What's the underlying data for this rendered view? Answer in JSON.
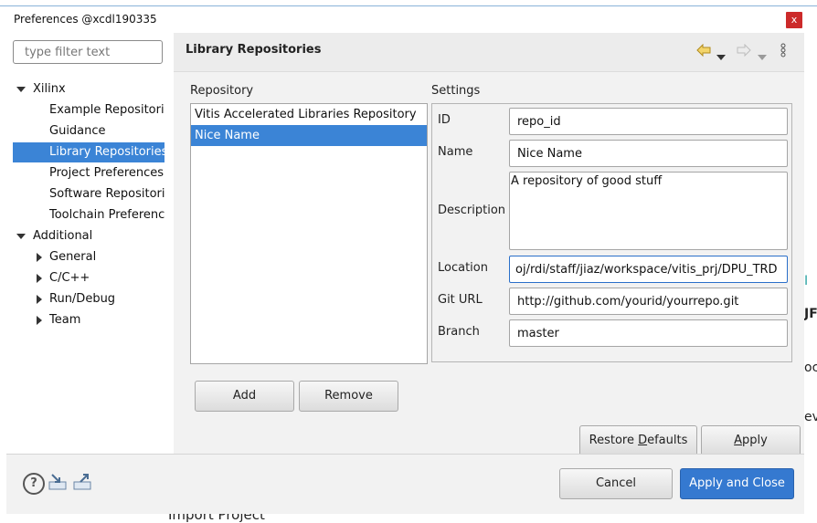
{
  "window": {
    "title": "Preferences @xcdl190335",
    "close_glyph": "x"
  },
  "filter": {
    "placeholder": "type filter text"
  },
  "tree": [
    {
      "label": "Xilinx",
      "expanded": true,
      "level": 0
    },
    {
      "label": "Example Repositori",
      "level": 1
    },
    {
      "label": "Guidance",
      "level": 1
    },
    {
      "label": "Library Repositories",
      "level": 1,
      "selected": true
    },
    {
      "label": "Project Preferences",
      "level": 1
    },
    {
      "label": "Software Repositori",
      "level": 1
    },
    {
      "label": "Toolchain Preferenc",
      "level": 1
    },
    {
      "label": "Additional",
      "expanded": true,
      "level": 0
    },
    {
      "label": "General",
      "expanded": false,
      "level": 1
    },
    {
      "label": "C/C++",
      "expanded": false,
      "level": 1
    },
    {
      "label": "Run/Debug",
      "expanded": false,
      "level": 1
    },
    {
      "label": "Team",
      "expanded": false,
      "level": 1
    }
  ],
  "page": {
    "title": "Library Repositories"
  },
  "repository": {
    "label": "Repository",
    "items": [
      "Vitis Accelerated Libraries Repository",
      "Nice Name"
    ],
    "selected": "Nice Name"
  },
  "settings": {
    "label": "Settings",
    "id_label": "ID",
    "id_value": "repo_id",
    "name_label": "Name",
    "name_value": "Nice Name",
    "description_label": "Description",
    "description_value": "A repository of good stuff",
    "location_label": "Location",
    "location_value": "oj/rdi/staff/jiaz/workspace/vitis_prj/DPU_TRD",
    "giturl_label": "Git URL",
    "giturl_value": "http://github.com/yourid/yourrepo.git",
    "branch_label": "Branch",
    "branch_value": "master"
  },
  "buttons": {
    "add": "Add",
    "remove": "Remove",
    "restore_pre": "Restore ",
    "restore_u": "D",
    "restore_post": "efaults",
    "apply_u": "A",
    "apply_post": "pply",
    "cancel": "Cancel",
    "apply_close": "Apply and Close"
  },
  "background": {
    "bottom_text": "Import Project",
    "right_letters": [
      "I",
      "JF",
      "ocu",
      "ev"
    ]
  },
  "colors": {
    "selection": "#3b84d6",
    "primary_button": "#3579d0",
    "close_button": "#cc2a2a"
  }
}
